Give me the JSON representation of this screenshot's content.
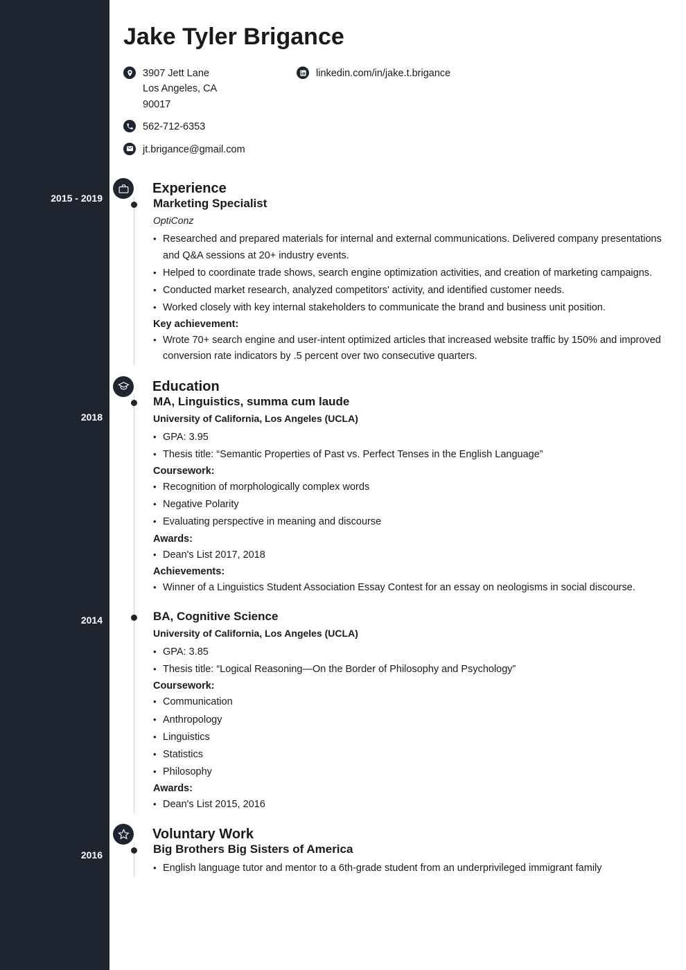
{
  "header": {
    "name": "Jake Tyler Brigance",
    "address_line1": "3907 Jett Lane",
    "address_line2": "Los Angeles, CA",
    "address_line3": "90017",
    "phone": "562-712-6353",
    "email": "jt.brigance@gmail.com",
    "linkedin": "linkedin.com/in/jake.t.brigance"
  },
  "sections": {
    "experience_title": "Experience",
    "education_title": "Education",
    "voluntary_title": "Voluntary Work"
  },
  "experience": {
    "date": "2015 - 2019",
    "title": "Marketing Specialist",
    "company": "OptiConz",
    "bullets": [
      "Researched and prepared materials for internal and external communications. Delivered company presentations and Q&A sessions at 20+ industry events.",
      "Helped to coordinate trade shows, search engine optimization activities, and creation of marketing campaigns.",
      "Conducted market research, analyzed competitors' activity, and identified customer needs.",
      "Worked closely with key internal stakeholders to communicate the brand and business unit position."
    ],
    "key_achievement_label": "Key achievement:",
    "key_achievement": "Wrote 70+ search engine and user-intent optimized articles that increased website traffic by 150% and improved conversion rate indicators by .5 percent over two consecutive quarters."
  },
  "education": [
    {
      "date": "2018",
      "degree": "MA, Linguistics, summa cum laude",
      "school": "University of California, Los Angeles (UCLA)",
      "bullets": [
        "GPA: 3.95",
        "Thesis title: “Semantic Properties of Past vs. Perfect Tenses in the English Language”"
      ],
      "coursework_label": "Coursework:",
      "coursework": [
        "Recognition of morphologically complex words",
        "Negative Polarity",
        "Evaluating perspective in meaning and discourse"
      ],
      "awards_label": "Awards:",
      "awards": [
        "Dean's List 2017, 2018"
      ],
      "achievements_label": "Achievements:",
      "achievements": [
        "Winner of a Linguistics Student Association Essay Contest for an essay on neologisms in social discourse."
      ]
    },
    {
      "date": "2014",
      "degree": "BA, Cognitive Science",
      "school": "University of California, Los Angeles (UCLA)",
      "bullets": [
        "GPA: 3.85",
        "Thesis title: “Logical Reasoning—On the Border of Philosophy and Psychology”"
      ],
      "coursework_label": "Coursework:",
      "coursework": [
        "Communication",
        "Anthropology",
        "Linguistics",
        "Statistics",
        "Philosophy"
      ],
      "awards_label": "Awards:",
      "awards": [
        "Dean's List 2015, 2016"
      ]
    }
  ],
  "voluntary": {
    "date": "2016",
    "title": "Big Brothers Big Sisters of America",
    "bullets": [
      "English language tutor and mentor to a 6th-grade student from an underprivileged immigrant family"
    ]
  }
}
